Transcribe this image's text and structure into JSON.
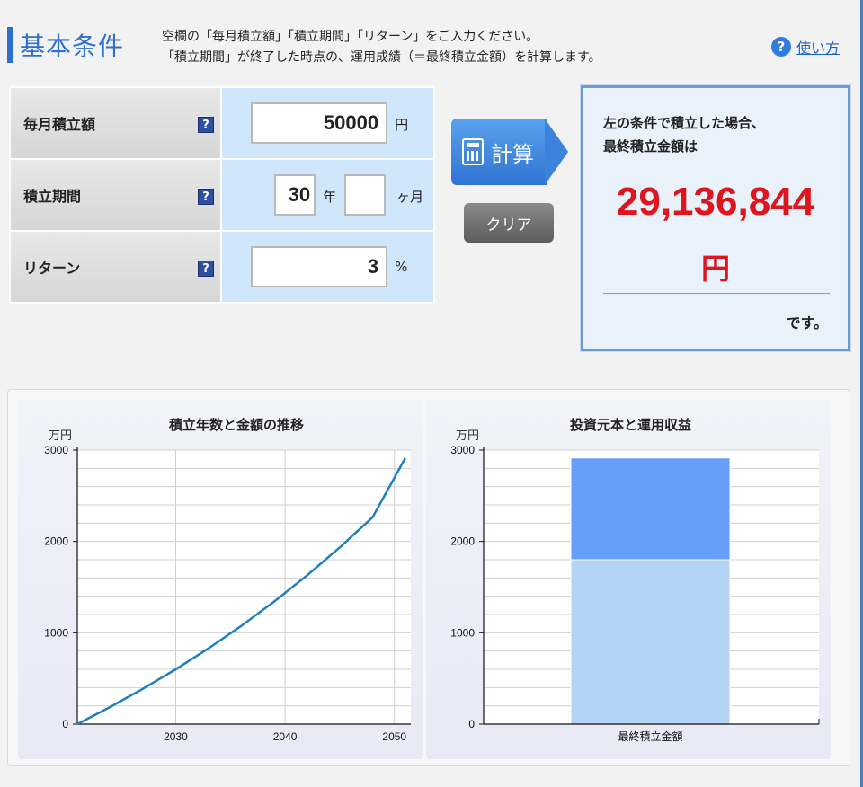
{
  "header": {
    "title": "基本条件",
    "desc_line1": "空欄の「毎月積立額」「積立期間」「リターン」をご入力ください。",
    "desc_line2": "「積立期間」が終了した時点の、運用成績（＝最終積立金額）を計算します。",
    "howto_icon": "?",
    "howto_label": "使い方"
  },
  "form": {
    "monthly": {
      "label": "毎月積立額",
      "help": "?",
      "value": "50000",
      "unit": "円"
    },
    "period": {
      "label": "積立期間",
      "help": "?",
      "years": "30",
      "years_unit": "年",
      "months": "",
      "months_unit": "ヶ月"
    },
    "return": {
      "label": "リターン",
      "help": "?",
      "value": "3",
      "unit": "%"
    }
  },
  "buttons": {
    "calc": "計算",
    "clear": "クリア"
  },
  "result": {
    "line1": "左の条件で積立した場合、",
    "line2": "最終積立金額は",
    "amount": "29,136,844",
    "yen": "円",
    "suffix": "です。"
  },
  "colors": {
    "accent": "#2f6fd0",
    "result_red": "#e0141c",
    "line": "#1f7fbf",
    "bar_principal": "#b3d4f5",
    "bar_gain": "#679dfb"
  },
  "chart_data": [
    {
      "type": "line",
      "title": "積立年数と金額の推移",
      "ylabel": "万円",
      "xlabel": "",
      "ylim": [
        0,
        3000
      ],
      "xlim": [
        2021,
        2051.5
      ],
      "yticks": [
        "0",
        "1000",
        "2000",
        "3000"
      ],
      "xticks": [
        "2030",
        "2040",
        "2050"
      ],
      "xtick_values": [
        2030,
        2040,
        2050
      ],
      "ytick_values": [
        0,
        1000,
        2000,
        3000
      ],
      "grid": true,
      "series": [
        {
          "x": [
            2021,
            2024,
            2027,
            2030,
            2033,
            2036,
            2039,
            2042,
            2045,
            2048,
            2051
          ],
          "values": [
            0,
            187,
            387,
            600,
            829,
            1076,
            1341,
            1627,
            1934,
            2264,
            2914
          ]
        }
      ]
    },
    {
      "type": "bar",
      "title": "投資元本と運用収益",
      "ylabel": "万円",
      "ylim": [
        0,
        3000
      ],
      "yticks": [
        "0",
        "1000",
        "2000",
        "3000"
      ],
      "ytick_values": [
        0,
        1000,
        2000,
        3000
      ],
      "categories": [
        "最終積立金額"
      ],
      "grid": true,
      "stacked": true,
      "series": [
        {
          "values": [
            1800
          ]
        },
        {
          "values": [
            1114
          ]
        }
      ]
    }
  ]
}
